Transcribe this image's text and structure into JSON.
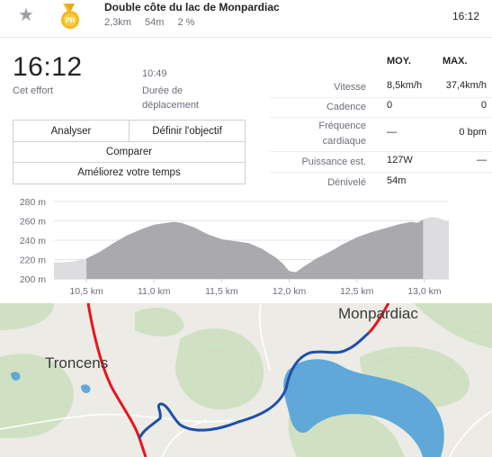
{
  "segment": {
    "star_icon": "star-icon",
    "medal_icon": "pr-medal-icon",
    "medal_label": "PR",
    "name": "Double côte du lac de Monpardiac",
    "distance": "2,3km",
    "elevation": "54m",
    "grade": "2 %",
    "time": "16:12"
  },
  "effort": {
    "time": "16:12",
    "time_label": "Cet effort",
    "moving_time": "10:49",
    "moving_label": "Durée de déplacement"
  },
  "buttons": {
    "analyze": "Analyser",
    "set_goal": "Définir l'objectif",
    "compare": "Comparer",
    "improve": "Améliorez votre temps"
  },
  "stats": {
    "head_avg": "MOY.",
    "head_max": "MAX.",
    "rows": [
      {
        "label": "Vitesse",
        "avg": "8,5km/h",
        "max": "37,4km/h"
      },
      {
        "label": "Cadence",
        "avg": "0",
        "max": "0"
      },
      {
        "label": "Fréquence cardiaque",
        "avg": "—",
        "max": "0 bpm"
      },
      {
        "label": "Puissance est.",
        "avg": "127W",
        "max": "—"
      },
      {
        "label": "Dénivelé",
        "avg": "54m",
        "max": ""
      }
    ]
  },
  "chart_data": {
    "type": "area",
    "x_tick_labels": [
      "10,5 km",
      "11,0 km",
      "11,5 km",
      "12,0 km",
      "12,5 km",
      "13,0 km"
    ],
    "x_ticks": [
      10.5,
      11.0,
      11.5,
      12.0,
      12.5,
      13.0
    ],
    "y_tick_labels": [
      "280 m",
      "260 m",
      "240 m",
      "220 m",
      "200 m"
    ],
    "y_ticks": [
      280,
      260,
      240,
      220,
      200
    ],
    "xlim": [
      10.26,
      13.18
    ],
    "ylim": [
      200,
      280
    ],
    "segment_range": [
      10.5,
      12.99
    ],
    "x": [
      10.26,
      10.3,
      10.4,
      10.5,
      10.6,
      10.7,
      10.8,
      10.9,
      11.0,
      11.1,
      11.15,
      11.2,
      11.3,
      11.4,
      11.5,
      11.6,
      11.7,
      11.8,
      11.9,
      11.95,
      12.0,
      12.05,
      12.1,
      12.2,
      12.3,
      12.4,
      12.5,
      12.6,
      12.7,
      12.8,
      12.9,
      12.95,
      13.0,
      13.05,
      13.1,
      13.18
    ],
    "y": [
      217,
      217,
      218,
      221,
      228,
      237,
      245,
      251,
      256,
      258,
      259,
      258,
      253,
      246,
      241,
      239,
      237,
      231,
      222,
      216,
      208,
      207,
      212,
      221,
      228,
      236,
      243,
      248,
      252,
      256,
      259,
      258,
      262,
      264,
      263,
      259
    ],
    "fill_segment": "#a9a9ae",
    "fill_outside": "#dddde0"
  },
  "map": {
    "label_left": "Troncens",
    "label_right": "Monpardiac",
    "route_color": "#1f4fa8",
    "road_color": "#e8141c",
    "water_color": "#5fa8d8",
    "forest_color": "#cfe1c2",
    "land_color": "#ecebe6"
  }
}
